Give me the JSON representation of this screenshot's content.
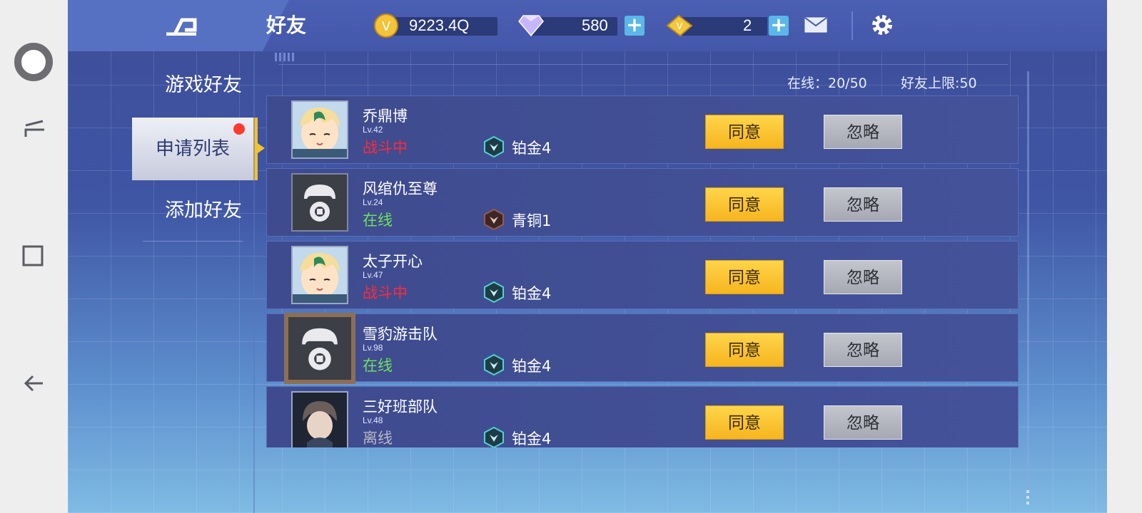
{
  "topbar": {
    "title": "好友",
    "gold": {
      "value": "9223.4Q",
      "icon": "coin-icon"
    },
    "diamond": {
      "value": "580",
      "icon": "diamond-icon"
    },
    "ticket": {
      "value": "2",
      "icon": "ticket-icon"
    },
    "plus": "+"
  },
  "menu": {
    "items": [
      {
        "label": "游戏好友"
      },
      {
        "label": "申请列表"
      },
      {
        "label": "添加好友"
      }
    ]
  },
  "stats": {
    "online": "在线：20/50",
    "limit": "好友上限:50"
  },
  "buttons": {
    "agree": "同意",
    "ignore": "忽略"
  },
  "colors": {
    "status_battle": "#ff2a3a",
    "status_online": "#6ee05a",
    "status_offline": "#b9b9c4"
  },
  "requests": [
    {
      "name": "乔鼎博",
      "level": "Lv.42",
      "status": "战斗中",
      "rank": "铂金4"
    },
    {
      "name": "风绾仇至尊",
      "level": "Lv.24",
      "status": "在线",
      "rank": "青铜1"
    },
    {
      "name": "太子开心",
      "level": "Lv.47",
      "status": "战斗中",
      "rank": "铂金4"
    },
    {
      "name": "雪豹游击队",
      "level": "Lv.98",
      "status": "在线",
      "rank": "铂金4"
    },
    {
      "name": "三好班部队",
      "level": "Lv.48",
      "status": "离线",
      "rank": "铂金4"
    }
  ]
}
